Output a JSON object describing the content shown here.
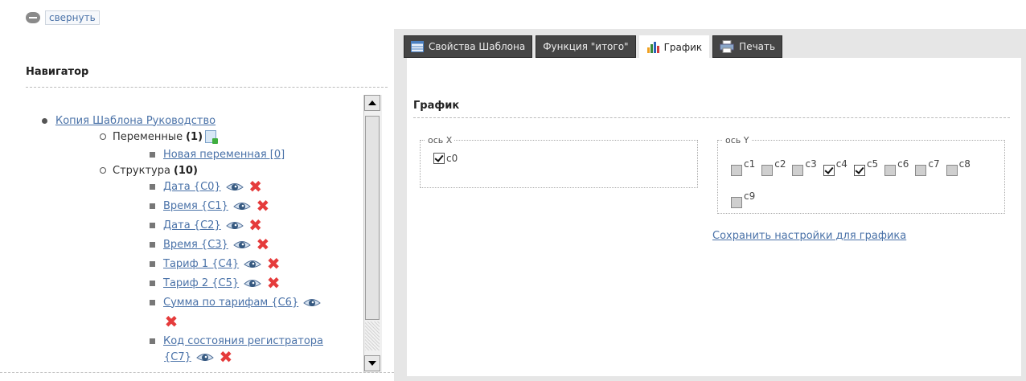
{
  "collapse_label": "свернуть",
  "navigator": {
    "title": "Навигатор",
    "root": "Копия Шаблона Руководство",
    "variables": {
      "label": "Переменные",
      "count": "(1)"
    },
    "new_variable": "Новая переменная [0]",
    "structure": {
      "label": "Структура",
      "count": "(10)"
    },
    "items": [
      "Дата {C0}",
      "Время {C1}",
      "Дата {C2}",
      "Время {C3}",
      "Тариф 1 {C4}",
      "Тариф 2 {C5}",
      "Сумма по тарифам {C6}",
      "Код состояния регистратора",
      "{C7}"
    ]
  },
  "tabs": [
    {
      "label": "Свойства Шаблона",
      "icon": "table-icon"
    },
    {
      "label": "Функция \"итого\"",
      "icon": ""
    },
    {
      "label": "График",
      "icon": "bar-chart-icon",
      "active": true
    },
    {
      "label": "Печать",
      "icon": "printer-icon"
    }
  ],
  "chart_settings": {
    "title": "График",
    "x_axis": {
      "legend": "ось X",
      "options": [
        {
          "label": "c0",
          "checked": true
        }
      ]
    },
    "y_axis": {
      "legend": "ось Y",
      "options": [
        {
          "label": "c1",
          "checked": false
        },
        {
          "label": "c2",
          "checked": false
        },
        {
          "label": "c3",
          "checked": false
        },
        {
          "label": "c4",
          "checked": true
        },
        {
          "label": "c5",
          "checked": true
        },
        {
          "label": "c6",
          "checked": false
        },
        {
          "label": "c7",
          "checked": false
        },
        {
          "label": "c8",
          "checked": false
        },
        {
          "label": "c9",
          "checked": false
        }
      ]
    },
    "save_link": "Сохранить настройки для графика"
  },
  "colors": {
    "link": "#4a72a8",
    "tab_dark": "#454545",
    "delete": "#e53b3b"
  }
}
